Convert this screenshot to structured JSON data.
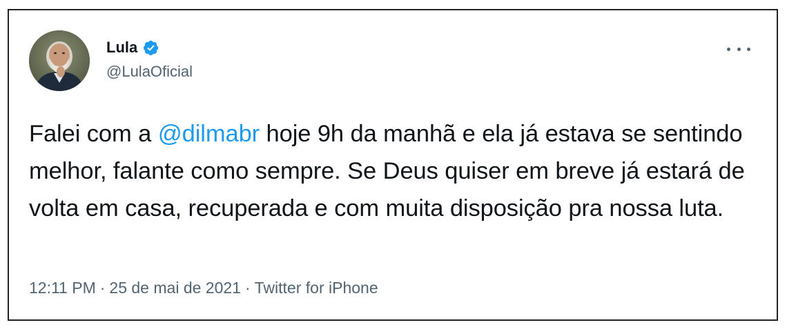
{
  "tweet": {
    "author": {
      "display_name": "Lula",
      "handle": "@LulaOficial",
      "verified": true,
      "avatar": "profile-photo"
    },
    "text": {
      "before_mention": "Falei com a ",
      "mention": "@dilmabr",
      "after_mention": " hoje 9h da manhã e ela já estava se sentindo melhor, falante como sempre. Se Deus quiser em breve já estará de volta em casa, recuperada e com muita disposição pra nossa luta."
    },
    "meta": {
      "time": "12:11 PM",
      "separator": "·",
      "date": "25 de mai de 2021",
      "source": "Twitter for iPhone"
    },
    "more_icon": "more-horizontal-icon"
  },
  "colors": {
    "text": "#0f1419",
    "secondary": "#536471",
    "link": "#1d9bf0",
    "verified": "#1d9bf0",
    "border": "#222222"
  }
}
